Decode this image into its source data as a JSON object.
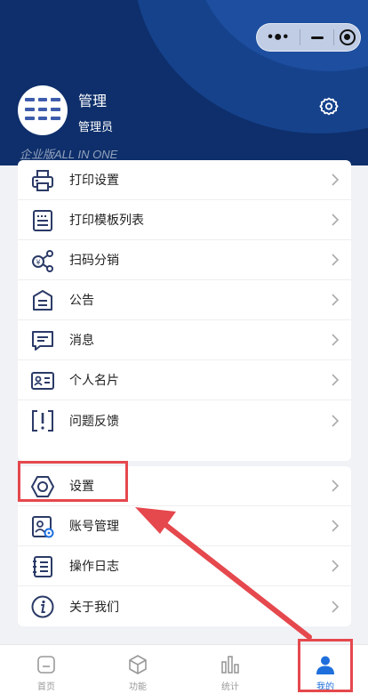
{
  "header": {
    "user_name": "管理",
    "user_role": "管理员",
    "edition": "企业版ALL IN ONE"
  },
  "capsule": {
    "more": "•●•"
  },
  "menu_group1": [
    {
      "label": "打印设置",
      "icon": "printer-icon"
    },
    {
      "label": "打印模板列表",
      "icon": "template-list-icon"
    },
    {
      "label": "扫码分销",
      "icon": "distribution-icon"
    },
    {
      "label": "公告",
      "icon": "announcement-icon"
    },
    {
      "label": "消息",
      "icon": "message-icon"
    },
    {
      "label": "个人名片",
      "icon": "business-card-icon"
    },
    {
      "label": "问题反馈",
      "icon": "feedback-icon"
    }
  ],
  "menu_group2": [
    {
      "label": "设置",
      "icon": "hexagon-settings-icon"
    },
    {
      "label": "账号管理",
      "icon": "account-manage-icon"
    },
    {
      "label": "操作日志",
      "icon": "log-icon"
    },
    {
      "label": "关于我们",
      "icon": "info-icon"
    }
  ],
  "tabbar": [
    {
      "label": "首页",
      "icon": "home-icon",
      "active": false
    },
    {
      "label": "功能",
      "icon": "cube-icon",
      "active": false
    },
    {
      "label": "统计",
      "icon": "bar-chart-icon",
      "active": false
    },
    {
      "label": "我的",
      "icon": "person-icon",
      "active": true
    }
  ],
  "colors": {
    "header": "#0e2f6b",
    "accent": "#1e6fdc",
    "annotation": "#e5484d"
  }
}
